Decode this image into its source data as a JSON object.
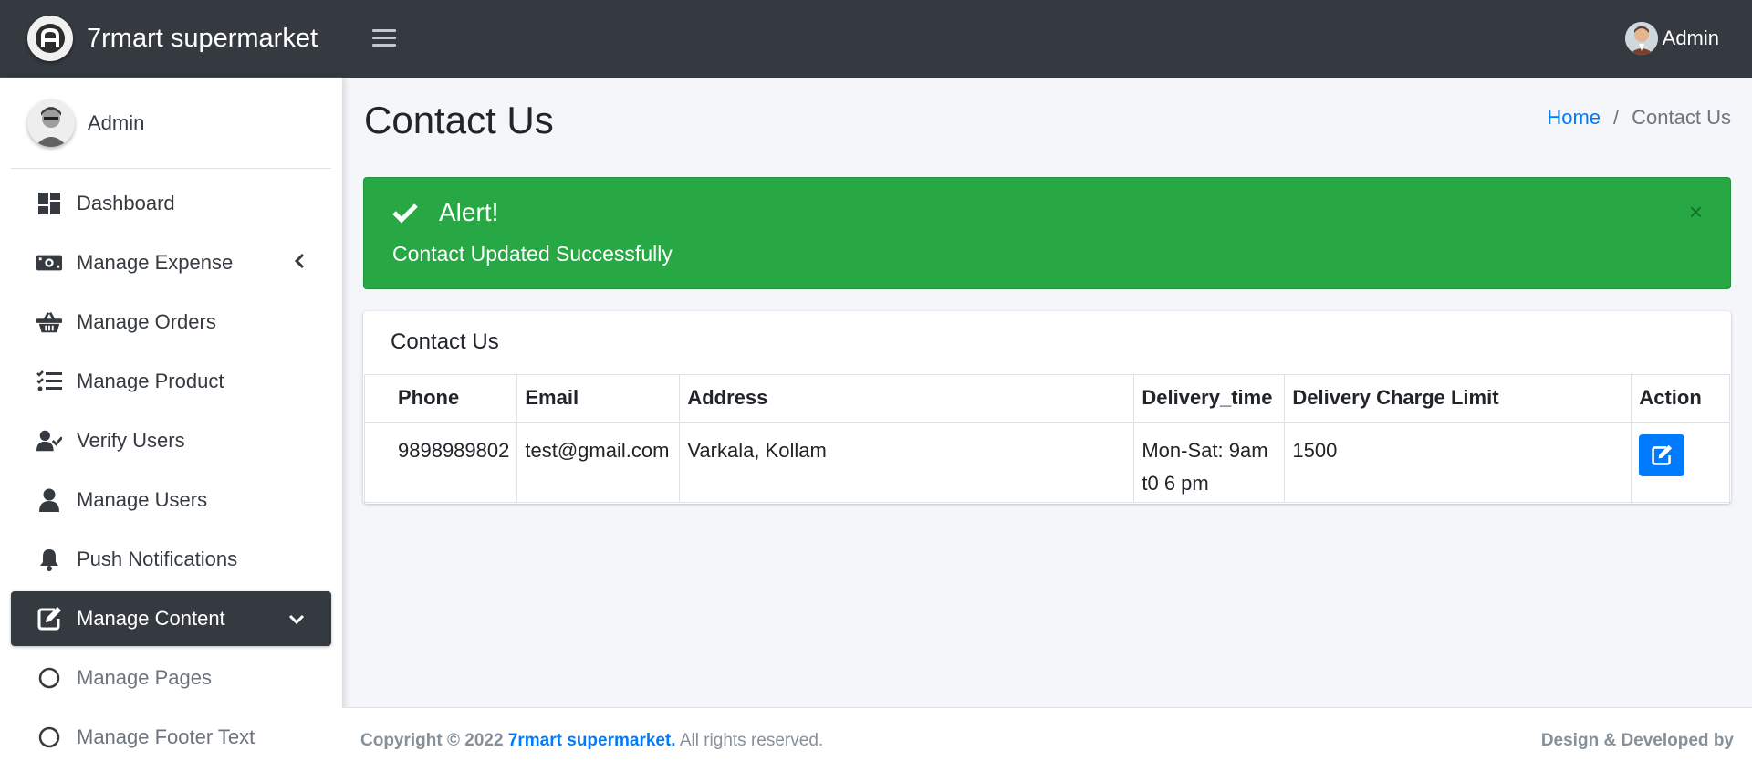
{
  "brand": {
    "name": "7rmart supermarket"
  },
  "topbar": {
    "user_name": "Admin"
  },
  "sidebar": {
    "user_name": "Admin",
    "items": [
      {
        "label": "Dashboard"
      },
      {
        "label": "Manage Expense"
      },
      {
        "label": "Manage Orders"
      },
      {
        "label": "Manage Product"
      },
      {
        "label": "Verify Users"
      },
      {
        "label": "Manage Users"
      },
      {
        "label": "Push Notifications"
      },
      {
        "label": "Manage Content"
      },
      {
        "label": "Manage Pages"
      },
      {
        "label": "Manage Footer Text"
      }
    ]
  },
  "page": {
    "title": "Contact Us",
    "breadcrumb": {
      "home": "Home",
      "separator": "/",
      "current": "Contact Us"
    }
  },
  "alert": {
    "heading": "Alert!",
    "message": "Contact Updated Successfully",
    "close": "×",
    "color": "#28a745"
  },
  "card": {
    "title": "Contact Us",
    "table": {
      "headers": [
        "Phone",
        "Email",
        "Address",
        "Delivery_time",
        "Delivery Charge Limit",
        "Action"
      ],
      "rows": [
        {
          "phone": "9898989802",
          "email": "test@gmail.com",
          "address": "Varkala, Kollam",
          "delivery_time": "Mon-Sat: 9am t0 6 pm",
          "charge_limit": "1500"
        }
      ]
    }
  },
  "footer": {
    "copyright": "Copyright © 2022",
    "brand": "7rmart supermarket.",
    "rights": "All rights reserved.",
    "right_text": "Design & Developed by"
  },
  "colors": {
    "primary": "#007bff",
    "dark": "#343a40",
    "success": "#28a745"
  }
}
